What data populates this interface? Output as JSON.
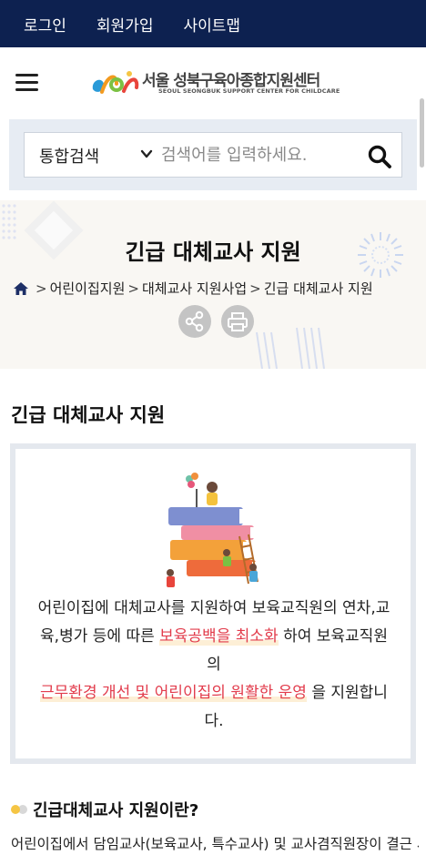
{
  "topbar": {
    "links": [
      "로그인",
      "회원가입",
      "사이트맵"
    ]
  },
  "header": {
    "logo_title": "서울 성북구육아종합지원센터",
    "logo_subtitle": "SEOUL SEONGBUK SUPPORT CENTER FOR CHILDCARE"
  },
  "search": {
    "select_value": "통합검색",
    "placeholder": "검색어를 입력하세요."
  },
  "hero": {
    "title": "긴급 대체교사 지원",
    "breadcrumb": [
      "어린이집지원",
      "대체교사 지원사업",
      "긴급 대체교사 지원"
    ]
  },
  "main": {
    "section_title": "긴급 대체교사 지원",
    "intro": {
      "part1": "어린이집에 대체교사를 지원하여 보육교직원의 연차,교육,병가 등에 따른 ",
      "highlight1": "보육공백을 최소화",
      "part2": " 하여 보육교직원의",
      "highlight2": "근무환경 개선 및 어린이집의 원활한 운영",
      "part3": " 을 지원합니다."
    },
    "subheading": "긴급대체교사 지원이란?",
    "body": "어린이집에서 담임교사(보육교사, 특수교사) 및 교사겸직원장이 결근 시 연가, 병가, 교육 등으로 인한 부재 시 대체교사를 지원합니다."
  },
  "colors": {
    "topbar": "#0d2150",
    "search_bg": "#e7ecf3",
    "highlight_text": "#e23c4c",
    "highlight_bg": "#fdefd6",
    "box_border": "#e4e8ee",
    "dot_primary": "#f5c544",
    "dot_secondary": "#d8d8d8"
  }
}
